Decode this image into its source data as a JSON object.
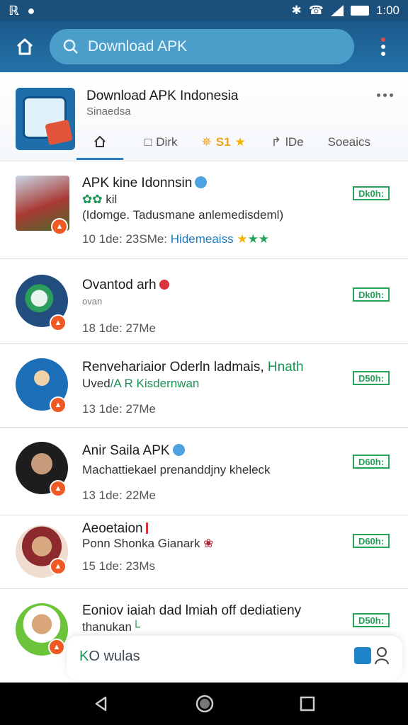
{
  "status_bar": {
    "time": "1:00",
    "left_icons": [
      "notification-icon",
      "messenger-icon"
    ],
    "right_icons": [
      "bluetooth-icon",
      "vibrate-icon",
      "signal-icon",
      "battery-icon"
    ]
  },
  "app_bar": {
    "search_value": "Download APK"
  },
  "channel": {
    "title": "Download APK Indonesia",
    "subtitle": "Sinaedsa",
    "tabs": [
      {
        "label": "",
        "icon": "home-icon"
      },
      {
        "label": "Dirk",
        "icon": "chat-icon"
      },
      {
        "label": "S1",
        "icon": "sparkle-icon"
      },
      {
        "label": "lDe",
        "icon": "share-icon"
      },
      {
        "label": "Soeaics",
        "icon": ""
      }
    ]
  },
  "feed": [
    {
      "title": "APK kine Idonnsin",
      "sub_a": "kil",
      "sub_b": "(Idomge. Tadusmane anlemedisdeml)",
      "meta": "10 1de: 23SMe:",
      "meta_link": "Hidemeaiss",
      "badge": "Dk0h:"
    },
    {
      "title": "Ovantod arh",
      "sub_a": "ovan",
      "meta": "18 1de: 27Me",
      "badge": "Dk0h:"
    },
    {
      "title": "Renvehariaior Oderln ladmais,",
      "title_green": "Hnath",
      "sub_a": "Uved",
      "sub_b": "A R Kisdernwan",
      "meta": "13 1de: 27Me",
      "badge": "D50h:"
    },
    {
      "title": "Anir Saila APK",
      "sub_a": "Machattiekael prenanddjny kheleck",
      "meta": "13 1de: 22Me",
      "badge": "D60h:"
    },
    {
      "title": "Aeoetaion",
      "sub_a": "Ponn Shonka Gianark",
      "meta": "15 1de: 23Ms",
      "badge": "D60h:"
    },
    {
      "title": "Eoniov iaiah dad lmiah off dediatieny",
      "sub_a": "thanukan",
      "badge": "D50h:"
    }
  ],
  "float_bar": {
    "label_a": "K",
    "label_b": "O wulas"
  },
  "colors": {
    "header_blue": "#1c5a8c",
    "accent_green": "#26a25b",
    "badge_orange": "#ef5a24",
    "link_blue": "#1d7ab8"
  }
}
